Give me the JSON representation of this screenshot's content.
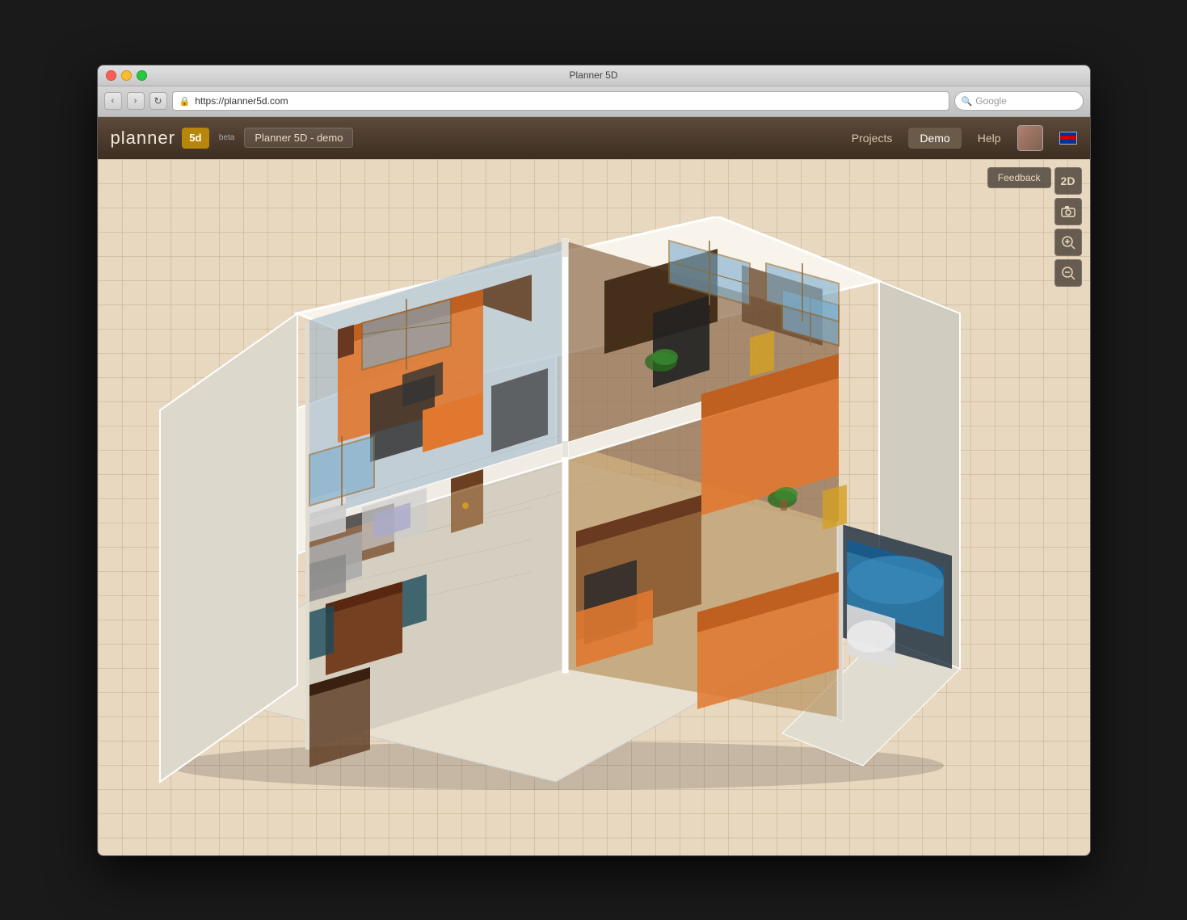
{
  "window": {
    "title": "Planner 5D",
    "url": "https://planner5d.com"
  },
  "header": {
    "logo_text": "planner",
    "logo_5d": "5d",
    "beta_label": "beta",
    "project_name": "Planner 5D - demo",
    "nav_items": [
      {
        "label": "Projects",
        "active": false
      },
      {
        "label": "Demo",
        "active": true
      },
      {
        "label": "Help",
        "active": false
      }
    ]
  },
  "toolbar": {
    "feedback_label": "Feedback",
    "view2d_label": "2D",
    "screenshot_icon": "camera",
    "zoom_in_icon": "zoom-in",
    "zoom_out_icon": "zoom-out"
  },
  "addressbar": {
    "url": "https://planner5d.com",
    "search_placeholder": "Google"
  },
  "titlebar": {
    "title": "Planner 5D"
  }
}
